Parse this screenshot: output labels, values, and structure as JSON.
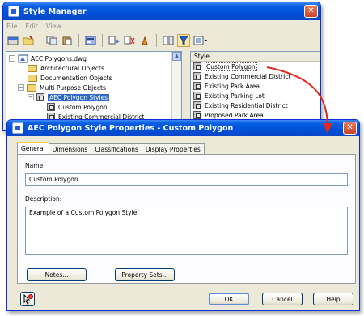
{
  "style_manager": {
    "title": "Style Manager",
    "close_glyph": "✕",
    "menu": [
      "File",
      "Edit",
      "View"
    ],
    "tree": [
      {
        "label": "AEC Polygons.dwg",
        "icon": "drawing-icon",
        "level": 0,
        "expander": "−"
      },
      {
        "label": "Architectural Objects",
        "icon": "folder-icon",
        "level": 1
      },
      {
        "label": "Documentation Objects",
        "icon": "folder-icon",
        "level": 1
      },
      {
        "label": "Multi-Purpose Objects",
        "icon": "folder-icon",
        "level": 1,
        "expander": "−"
      },
      {
        "label": "AEC Polygon Styles",
        "icon": "style-folder-icon",
        "level": 2,
        "expander": "−",
        "selected": true
      },
      {
        "label": "Custom Polygon",
        "icon": "style-icon",
        "level": 3
      },
      {
        "label": "Existing Commercial District",
        "icon": "style-icon",
        "level": 3
      }
    ],
    "list_header": "Style",
    "list_items": [
      "Custom Polygon",
      "Existing Commercial District",
      "Existing Park Area",
      "Existing Parking Lot",
      "Existing Residential District",
      "Proposed Park Area"
    ]
  },
  "props_dialog": {
    "title": "AEC Polygon Style Properties - Custom Polygon",
    "close_glyph": "✕",
    "tabs": [
      "General",
      "Dimensions",
      "Classifications",
      "Display Properties"
    ],
    "active_tab": "General",
    "name_label": "Name:",
    "name_value": "Custom Polygon",
    "description_label": "Description:",
    "description_value": "Example of a Custom Polygon Style",
    "notes_button": "Notes...",
    "property_sets_button": "Property Sets...",
    "ok_button": "OK",
    "cancel_button": "Cancel",
    "help_button": "Help"
  },
  "colors": {
    "arrow": "#e0281e",
    "titlebar": "#0050d8",
    "selection": "#316ac5"
  }
}
